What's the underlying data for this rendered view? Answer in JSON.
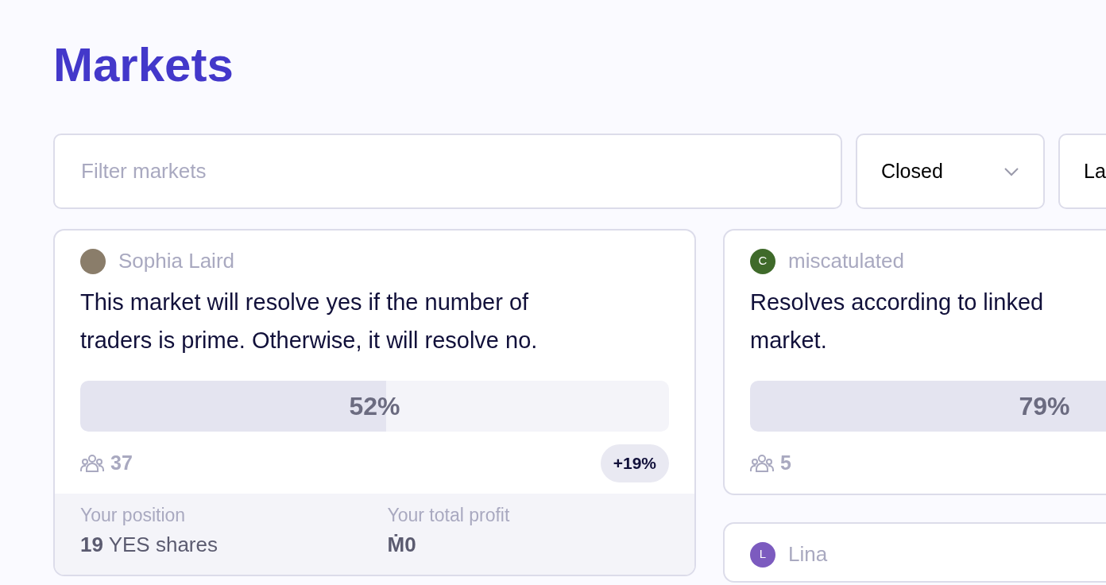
{
  "title": "Markets",
  "filter": {
    "placeholder": "Filter markets"
  },
  "selects": [
    {
      "value": "Closed"
    },
    {
      "value": "La"
    }
  ],
  "columns": [
    [
      {
        "creator": {
          "name": "Sophia Laird"
        },
        "question": "This market will resolve yes if the number of\ntraders is prime. Otherwise, it will resolve no.",
        "probability": "52%",
        "level": 0.52,
        "traders": "37",
        "profit_badge": "+19%",
        "position": {
          "label": "Your position",
          "amount": "19",
          "rest": "YES shares"
        },
        "profit": {
          "label": "Your total profit",
          "value": "Ṁ0"
        }
      }
    ],
    [
      {
        "creator": {
          "name": "miscatulated",
          "initial": "C",
          "color": "#3f6a2a"
        },
        "question": "Resolves according to linked\nmarket.",
        "probability": "79%",
        "level": 0.79,
        "traders": "5"
      },
      {
        "creator": {
          "name": "Lina",
          "initial": "L",
          "color": "#7c5bbf"
        }
      }
    ]
  ]
}
